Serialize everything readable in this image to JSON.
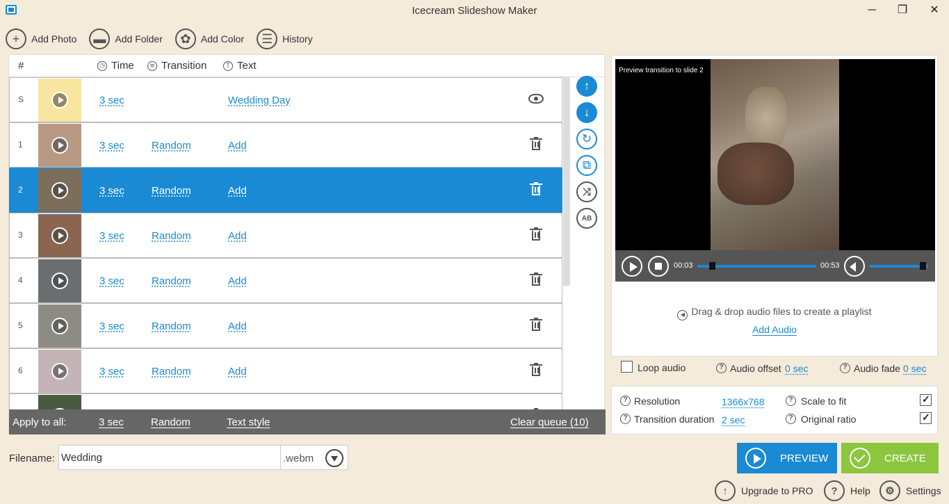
{
  "window": {
    "title": "Icecream Slideshow Maker"
  },
  "toolbar": {
    "add_photo": "Add Photo",
    "add_folder": "Add Folder",
    "add_color": "Add Color",
    "history": "History"
  },
  "table": {
    "col_num": "#",
    "col_time": "Time",
    "col_transition": "Transition",
    "col_text": "Text"
  },
  "slides": [
    {
      "num": "S",
      "time": "3 sec",
      "transition": "",
      "text": "Wedding Day",
      "thumb_color": "#f8e6a0",
      "selected": false,
      "action": "eye"
    },
    {
      "num": "1",
      "time": "3 sec",
      "transition": "Random",
      "text": "Add",
      "thumb_color": "#b89a84",
      "selected": false,
      "action": "delete"
    },
    {
      "num": "2",
      "time": "3 sec",
      "transition": "Random",
      "text": "Add",
      "thumb_color": "#7d6e5c",
      "selected": true,
      "action": "delete"
    },
    {
      "num": "3",
      "time": "3 sec",
      "transition": "Random",
      "text": "Add",
      "thumb_color": "#8a6650",
      "selected": false,
      "action": "delete"
    },
    {
      "num": "4",
      "time": "3 sec",
      "transition": "Random",
      "text": "Add",
      "thumb_color": "#6a6e70",
      "selected": false,
      "action": "delete"
    },
    {
      "num": "5",
      "time": "3 sec",
      "transition": "Random",
      "text": "Add",
      "thumb_color": "#8c8c84",
      "selected": false,
      "action": "delete"
    },
    {
      "num": "6",
      "time": "3 sec",
      "transition": "Random",
      "text": "Add",
      "thumb_color": "#c4b4b8",
      "selected": false,
      "action": "delete"
    },
    {
      "num": "",
      "time": "",
      "transition": "",
      "text": "",
      "thumb_color": "#4a5a40",
      "selected": false,
      "action": "delete"
    }
  ],
  "apply_all": {
    "label": "Apply to all:",
    "time": "3 sec",
    "transition": "Random",
    "text_style": "Text style",
    "clear_queue": "Clear queue (10)"
  },
  "filename": {
    "label": "Filename:",
    "value": "Wedding",
    "ext": ".webm"
  },
  "preview": {
    "caption": "Preview transition to slide 2",
    "current_time": "00:03",
    "total_time": "00:53",
    "progress": 0.12,
    "volume": 0.9
  },
  "audio": {
    "hint": "Drag & drop audio files to create a playlist",
    "add_audio": "Add Audio",
    "loop_label": "Loop audio",
    "loop_checked": false,
    "offset_label": "Audio offset",
    "offset_value": "0 sec",
    "fade_label": "Audio fade",
    "fade_value": "0 sec"
  },
  "settings": {
    "resolution_label": "Resolution",
    "resolution_value": "1366x768",
    "scale_label": "Scale to fit",
    "scale_checked": true,
    "duration_label": "Transition duration",
    "duration_value": "2 sec",
    "ratio_label": "Original ratio",
    "ratio_checked": true
  },
  "actions": {
    "preview": "PREVIEW",
    "create": "CREATE"
  },
  "footer": {
    "upgrade": "Upgrade to PRO",
    "help": "Help",
    "settings": "Settings"
  },
  "colors": {
    "accent": "#1a8ad4",
    "create": "#8cc63f",
    "background": "#f5ebdb",
    "applybar": "#666666"
  }
}
